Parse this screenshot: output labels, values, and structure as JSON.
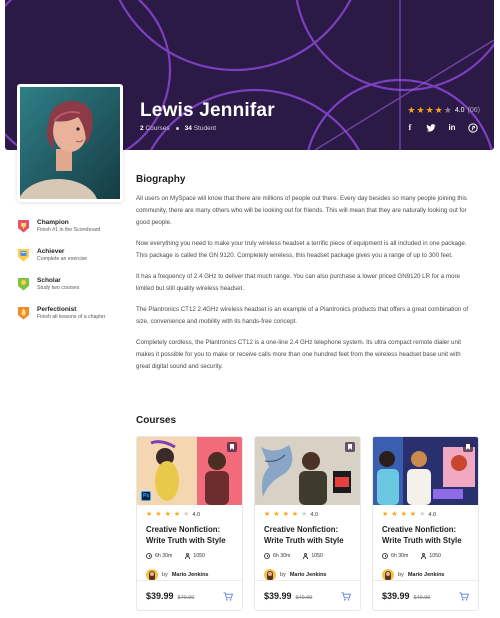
{
  "profile": {
    "name": "Lewis Jennifar",
    "courses_count": "2",
    "courses_label": "Courses",
    "students_count": "34",
    "students_label": "Student",
    "rating": "4.0",
    "rating_count": "(06)",
    "rating_value": 4,
    "socials": [
      "facebook-icon",
      "twitter-icon",
      "linkedin-icon",
      "pinterest-icon"
    ]
  },
  "achievements": [
    {
      "title": "Champion",
      "desc": "Finish #1 in the Scoreboard",
      "icon": "trophy-badge-icon",
      "color": "#e9536a"
    },
    {
      "title": "Achiever",
      "desc": "Complete an exercise",
      "icon": "book-badge-icon",
      "color": "#4a90e2"
    },
    {
      "title": "Scholar",
      "desc": "Study two courses",
      "icon": "scholar-badge-icon",
      "color": "#7cc243"
    },
    {
      "title": "Perfectionist",
      "desc": "Finish all lessons of a chapter",
      "icon": "flame-badge-icon",
      "color": "#f28a30"
    }
  ],
  "biography": {
    "title": "Biography",
    "paragraphs": [
      "All users on MySpace will know that there are millions of people out there. Every day besides so many people joining this community, there are many others who will be looking out for friends. This will mean that they are naturally looking out for good people.",
      "Now everything you need to make your truly wireless headset a terrific piece of equipment is all included in one package. This package is called the GN 9120. Completely wireless, this headset package gives you a range of up to 300 feet.",
      "It has a frequency of 2.4 GHz to deliver that much range. You can also purchase a lower priced GN9120 LR for a more limited but still quality wireless headset.",
      "The Plantronics CT12 2.4GHz wireless headset is an example of a Plantronics products that offers a great combination of size, convenience and mobility with its hands-free concept.",
      "Completely cordless, the Plantronics CT12 is a one-line 2.4 GHz telephone system. Its ultra compact remote dialer unit makes it possible for you to make or receive calls more than one hundred feet from the wireless headset base unit with great digital sound and security."
    ]
  },
  "courses_section": {
    "title": "Courses",
    "items": [
      {
        "rating": "4.0",
        "title": "Creative Nonfiction: Write Truth with Style",
        "duration": "6h 30m",
        "students": "1050",
        "by": "by",
        "author": "Mario Jenkins",
        "price": "$39.99",
        "old_price": "$49.99",
        "badge": "Ps"
      },
      {
        "rating": "4.0",
        "title": "Creative Nonfiction: Write Truth with Style",
        "duration": "6h 30m",
        "students": "1050",
        "by": "by",
        "author": "Mario Jenkins",
        "price": "$39.99",
        "old_price": "$49.99"
      },
      {
        "rating": "4.0",
        "title": "Creative Nonfiction: Write Truth with Style",
        "duration": "6h 30m",
        "students": "1050",
        "by": "by",
        "author": "Mario Jenkins",
        "price": "$39.99",
        "old_price": "$49.99"
      }
    ]
  },
  "colors": {
    "hero_bg": "#2a1a45",
    "hero_rings": "#8a46d6",
    "star": "#f8a61b",
    "cart": "#5b7be0"
  }
}
